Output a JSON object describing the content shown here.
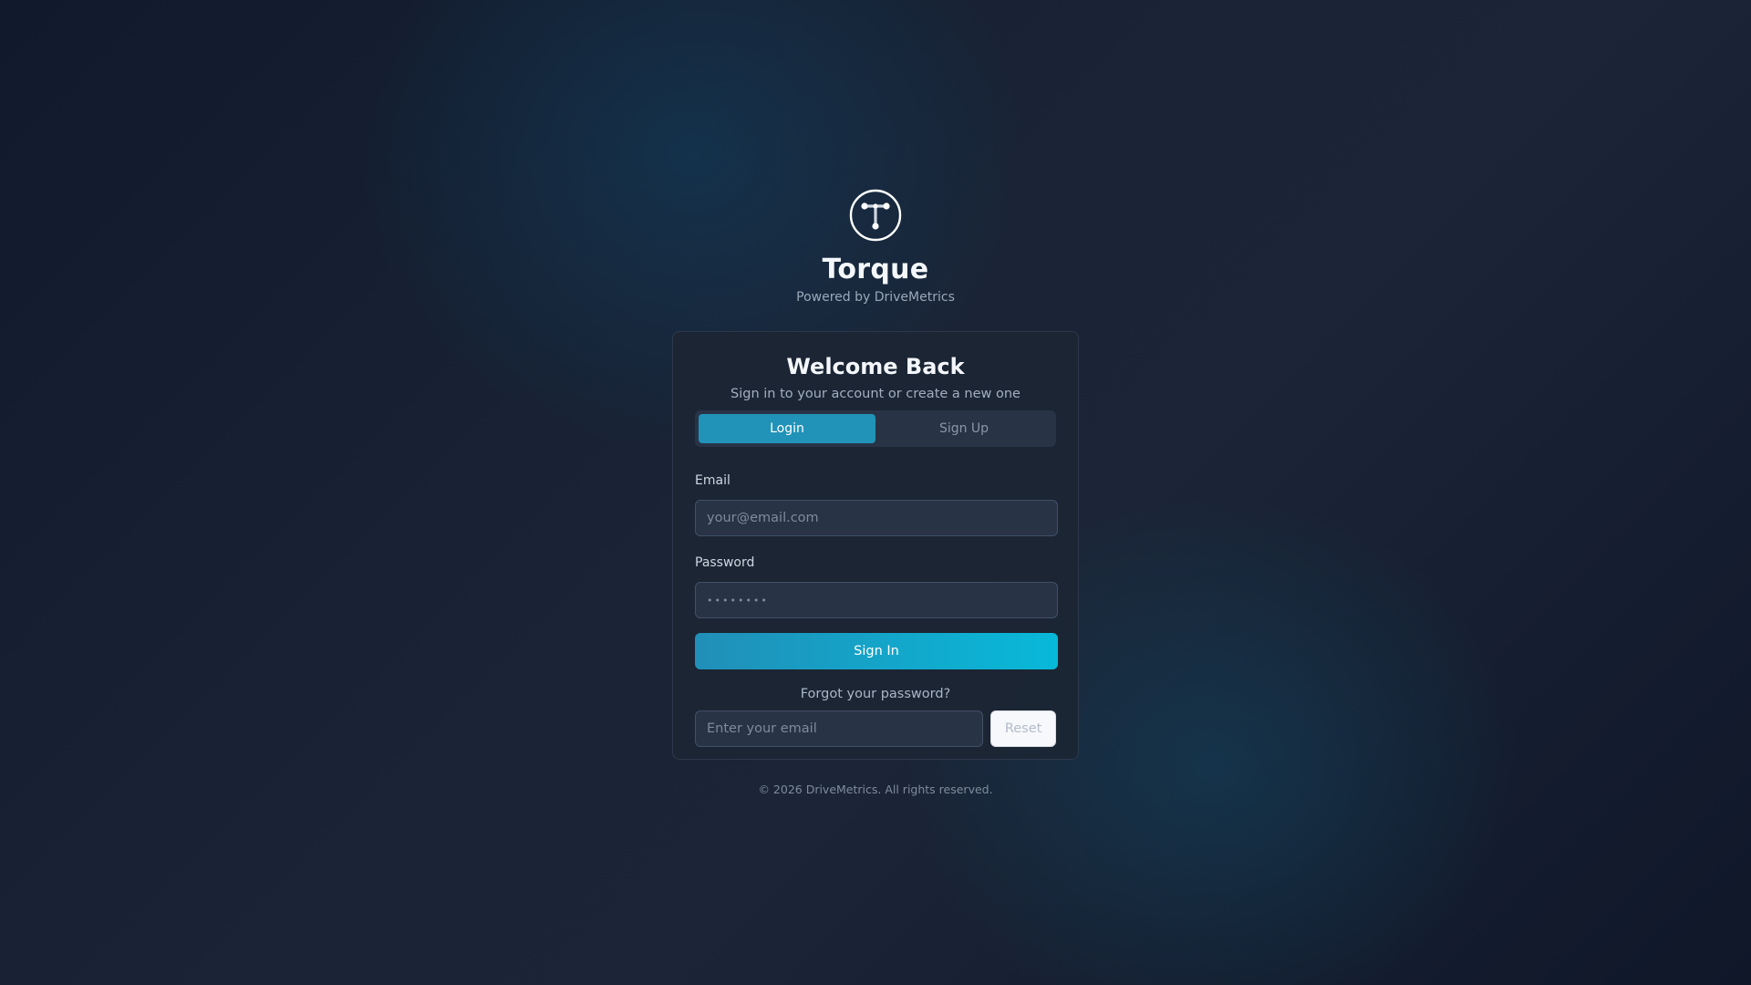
{
  "brand": {
    "logo_icon": "torque-logo-icon",
    "name": "Torque",
    "tagline": "Powered by DriveMetrics"
  },
  "card": {
    "title": "Welcome Back",
    "subtitle": "Sign in to your account or create a new one",
    "tabs": [
      {
        "label": "Login",
        "active": true
      },
      {
        "label": "Sign Up",
        "active": false
      }
    ],
    "email": {
      "label": "Email",
      "value": "",
      "placeholder": "your@email.com"
    },
    "password": {
      "label": "Password",
      "value": "",
      "placeholder": "••••••••"
    },
    "signin_label": "Sign In",
    "forgot": {
      "text": "Forgot your password?",
      "email_placeholder": "Enter your email",
      "reset_label": "Reset"
    }
  },
  "footer": {
    "text": "© 2026 DriveMetrics. All rights reserved."
  },
  "colors": {
    "accent": "#2193b8",
    "accent_bright": "#08b9d9",
    "card_bg": "#1c2533",
    "input_bg": "#283346"
  }
}
